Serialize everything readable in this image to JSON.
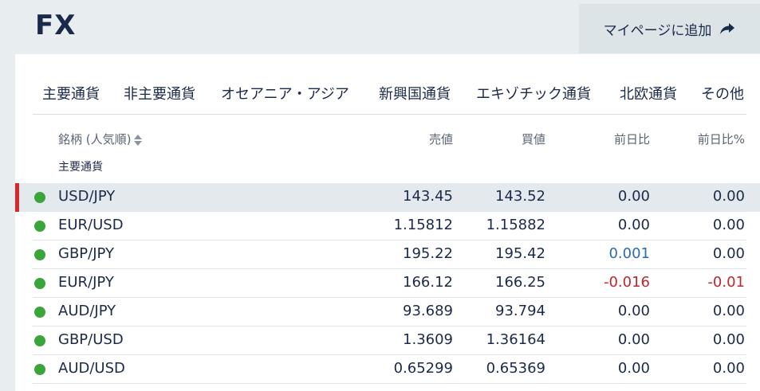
{
  "header": {
    "title": "FX",
    "mypage_button": "マイページに追加"
  },
  "tabs": [
    {
      "label": "主要通貨"
    },
    {
      "label": "非主要通貨"
    },
    {
      "label": "オセアニア・アジア"
    },
    {
      "label": "新興国通貨"
    },
    {
      "label": "エキゾチック通貨"
    },
    {
      "label": "北欧通貨"
    },
    {
      "label": "その他"
    }
  ],
  "table": {
    "columns": {
      "name": "銘柄 (人気順)",
      "sell": "売値",
      "buy": "買値",
      "change": "前日比",
      "change_pct": "前日比%"
    },
    "group_label": "主要通貨",
    "rows": [
      {
        "name": "USD/JPY",
        "sell": "143.45",
        "buy": "143.52",
        "change": "0.00",
        "change_pct": "0.00",
        "change_color": "#1b2a4a",
        "pct_color": "#1b2a4a"
      },
      {
        "name": "EUR/USD",
        "sell": "1.15812",
        "buy": "1.15882",
        "change": "0.00",
        "change_pct": "0.00",
        "change_color": "#1b2a4a",
        "pct_color": "#1b2a4a"
      },
      {
        "name": "GBP/JPY",
        "sell": "195.22",
        "buy": "195.42",
        "change": "0.001",
        "change_pct": "0.00",
        "change_color": "#2a6cb0",
        "pct_color": "#1b2a4a"
      },
      {
        "name": "EUR/JPY",
        "sell": "166.12",
        "buy": "166.25",
        "change": "-0.016",
        "change_pct": "-0.01",
        "change_color": "#c0262d",
        "pct_color": "#c0262d"
      },
      {
        "name": "AUD/JPY",
        "sell": "93.689",
        "buy": "93.794",
        "change": "0.00",
        "change_pct": "0.00",
        "change_color": "#1b2a4a",
        "pct_color": "#1b2a4a"
      },
      {
        "name": "GBP/USD",
        "sell": "1.3609",
        "buy": "1.36164",
        "change": "0.00",
        "change_pct": "0.00",
        "change_color": "#1b2a4a",
        "pct_color": "#1b2a4a"
      },
      {
        "name": "AUD/USD",
        "sell": "0.65299",
        "buy": "0.65369",
        "change": "0.00",
        "change_pct": "0.00",
        "change_color": "#1b2a4a",
        "pct_color": "#1b2a4a"
      }
    ]
  },
  "colors": {
    "status_dot": "#3aa53a",
    "selected_marker": "#d42a2a"
  },
  "icons": {
    "mypage": "share-arrow-icon",
    "sort": "sort-icon",
    "status": "status-dot-icon"
  }
}
